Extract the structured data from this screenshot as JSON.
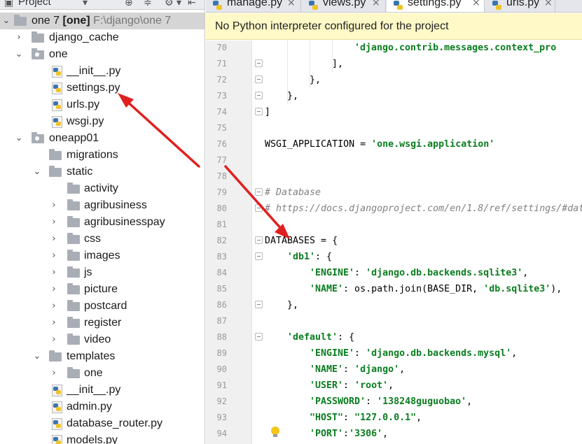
{
  "panel": {
    "title": "Project"
  },
  "tree": [
    {
      "label": "one 7",
      "badge": "[one]",
      "path": "F:\\django\\one 7"
    },
    {
      "label": "django_cache"
    },
    {
      "label": "one"
    },
    {
      "label": "__init__.py"
    },
    {
      "label": "settings.py"
    },
    {
      "label": "urls.py"
    },
    {
      "label": "wsgi.py"
    },
    {
      "label": "oneapp01"
    },
    {
      "label": "migrations"
    },
    {
      "label": "static"
    },
    {
      "label": "activity"
    },
    {
      "label": "agribusiness"
    },
    {
      "label": "agribusinesspay"
    },
    {
      "label": "css"
    },
    {
      "label": "images"
    },
    {
      "label": "js"
    },
    {
      "label": "picture"
    },
    {
      "label": "postcard"
    },
    {
      "label": "register"
    },
    {
      "label": "video"
    },
    {
      "label": "templates"
    },
    {
      "label": "one"
    },
    {
      "label": "__init__.py"
    },
    {
      "label": "admin.py"
    },
    {
      "label": "database_router.py"
    },
    {
      "label": "models.py"
    }
  ],
  "tabs": [
    {
      "label": "manage.py"
    },
    {
      "label": "views.py"
    },
    {
      "label": "settings.py"
    },
    {
      "label": "urls.py"
    }
  ],
  "warning": "No Python interpreter configured for the project",
  "line_numbers": [
    "70",
    "71",
    "72",
    "73",
    "74",
    "75",
    "76",
    "77",
    "78",
    "79",
    "80",
    "81",
    "82",
    "83",
    "84",
    "85",
    "86",
    "87",
    "88",
    "89",
    "90",
    "91",
    "92",
    "93",
    "94"
  ],
  "code": {
    "l70": "'django.contrib.messages.context_pro",
    "l71": "],",
    "l72": "},",
    "l73": "},",
    "l74": "]",
    "l76a": "WSGI_APPLICATION = ",
    "l76b": "'one.wsgi.application'",
    "l79": "# Database",
    "l80": "# https://docs.djangoproject.com/en/1.8/ref/settings/#dat",
    "l82": "DATABASES = {",
    "l83a": "'db1'",
    "l83b": ": {",
    "l84a": "'ENGINE'",
    "l84b": ": ",
    "l84c": "'django.db.backends.sqlite3'",
    "l84d": ",",
    "l85a": "'NAME'",
    "l85b": ": os.path.join(BASE_DIR, ",
    "l85c": "'db.sqlite3'",
    "l85d": "),",
    "l86": "},",
    "l88a": "'default'",
    "l88b": ": {",
    "l89a": "'ENGINE'",
    "l89b": ": ",
    "l89c": "'django.db.backends.mysql'",
    "l89d": ",",
    "l90a": "'NAME'",
    "l90b": ": ",
    "l90c": "'django'",
    "l90d": ",",
    "l91a": "'USER'",
    "l91b": ": ",
    "l91c": "'root'",
    "l91d": ",",
    "l92a": "'PASSWORD'",
    "l92b": ": ",
    "l92c": "'138248guguobao'",
    "l92d": ",",
    "l93a": "\"HOST\"",
    "l93b": ": ",
    "l93c": "\"127.0.0.1\"",
    "l93d": ",",
    "l94a": "'PORT'",
    "l94b": ":",
    "l94c": "'3306'",
    "l94d": ","
  },
  "colors": {
    "string": "#0a7d1f",
    "comment": "#808080",
    "warning_bg": "#fff9c7",
    "annotation_arrow": "#e02020"
  }
}
